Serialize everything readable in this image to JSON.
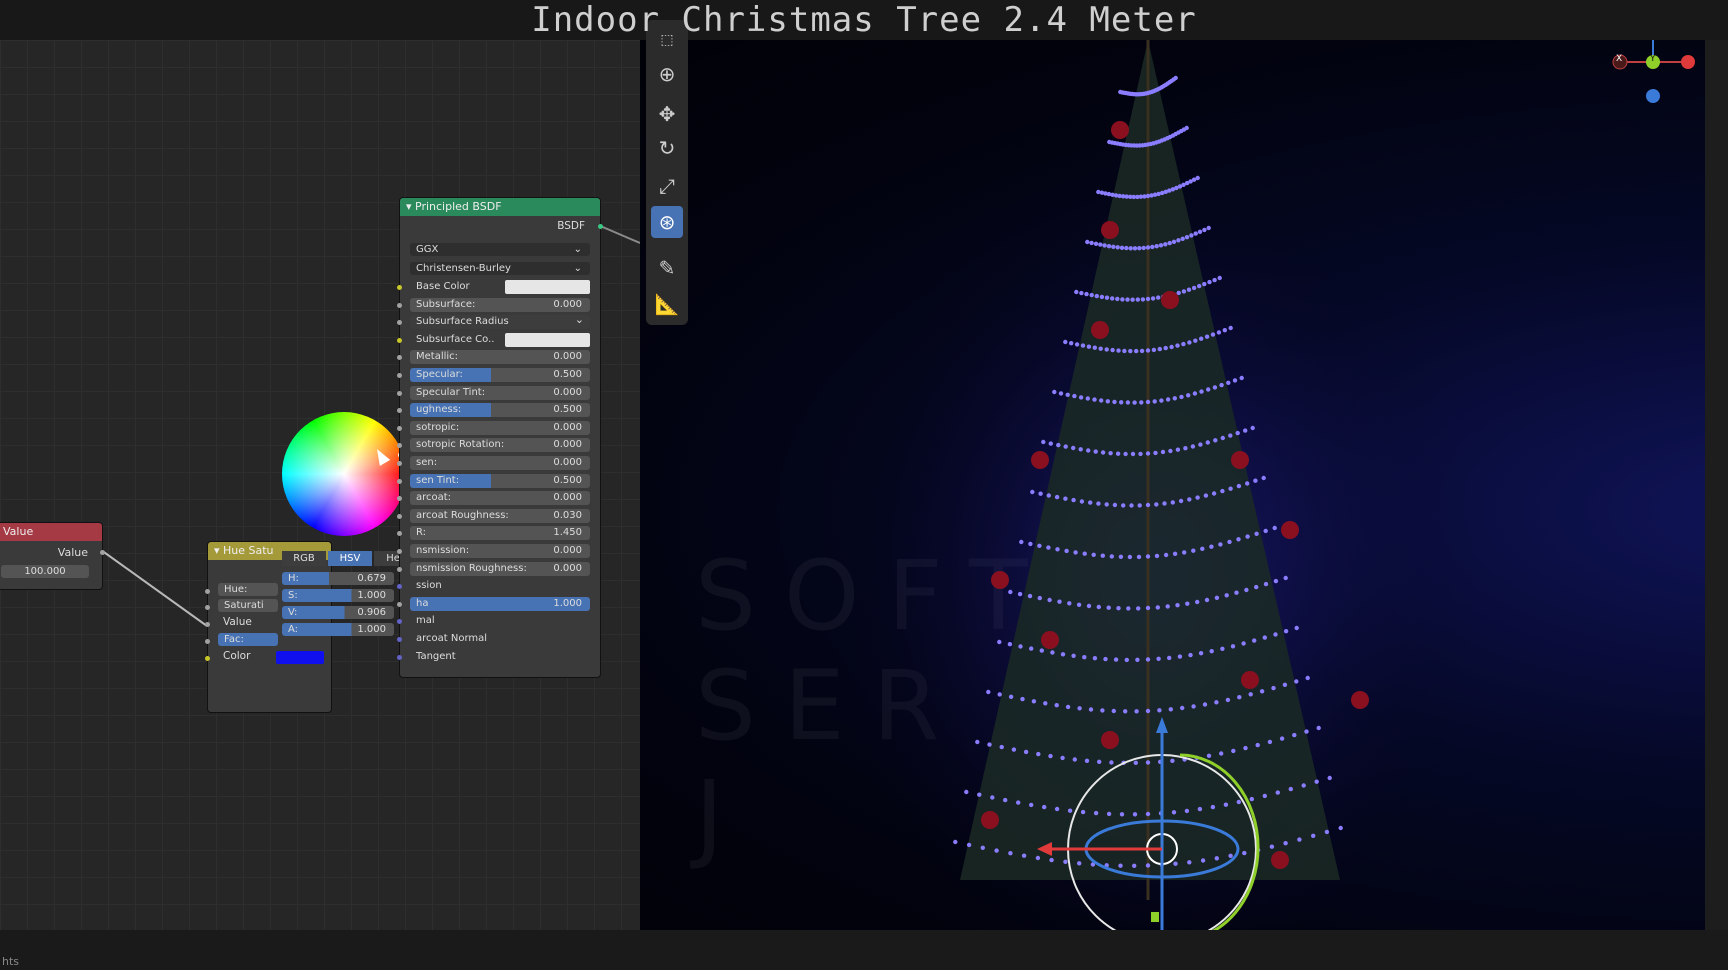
{
  "title": "Indoor Christmas Tree 2.4 Meter",
  "status_bar": {
    "text": "hts"
  },
  "value_node": {
    "header": "Value",
    "output_label": "Value",
    "value": "100.000"
  },
  "hue_node": {
    "header": "▾ Hue Satu",
    "inputs": [
      "Hue:",
      "Saturati",
      "Value",
      "Fac:",
      "Color"
    ],
    "color_swatch": "#1010ee"
  },
  "color_picker": {
    "tabs": [
      "RGB",
      "HSV",
      "Hex"
    ],
    "active_tab": "HSV",
    "fields": [
      {
        "label": "H:",
        "value": "0.679",
        "fraction": 0.679
      },
      {
        "label": "S:",
        "value": "1.000",
        "fraction": 1.0
      },
      {
        "label": "V:",
        "value": "0.906",
        "fraction": 0.906
      },
      {
        "label": "A:",
        "value": "1.000",
        "fraction": 1.0
      }
    ]
  },
  "bsdf_node": {
    "header": "▾ Principled BSDF",
    "output": "BSDF",
    "distribution": "GGX",
    "subsurface_method": "Christensen-Burley",
    "rows": [
      {
        "label": "Base Color",
        "type": "color"
      },
      {
        "label": "Subsurface:",
        "value": "0.000",
        "type": "slider"
      },
      {
        "label": "Subsurface Radius",
        "type": "dropdown"
      },
      {
        "label": "Subsurface Co..",
        "type": "color"
      },
      {
        "label": "Metallic:",
        "value": "0.000",
        "type": "slider"
      },
      {
        "label": "Specular:",
        "value": "0.500",
        "type": "slider-fill"
      },
      {
        "label": "Specular Tint:",
        "value": "0.000",
        "type": "slider"
      },
      {
        "label": "ughness:",
        "value": "0.500",
        "type": "slider-fill"
      },
      {
        "label": "sotropic:",
        "value": "0.000",
        "type": "slider"
      },
      {
        "label": "sotropic Rotation:",
        "value": "0.000",
        "type": "slider"
      },
      {
        "label": "sen:",
        "value": "0.000",
        "type": "slider"
      },
      {
        "label": "sen Tint:",
        "value": "0.500",
        "type": "slider-fill"
      },
      {
        "label": "arcoat:",
        "value": "0.000",
        "type": "slider"
      },
      {
        "label": "arcoat Roughness:",
        "value": "0.030",
        "type": "slider"
      },
      {
        "label": "R:",
        "value": "1.450",
        "type": "slider"
      },
      {
        "label": "nsmission:",
        "value": "0.000",
        "type": "slider"
      },
      {
        "label": "nsmission Roughness:",
        "value": "0.000",
        "type": "slider"
      },
      {
        "label": "ssion",
        "type": "socket-label"
      },
      {
        "label": "ha",
        "value": "1.000",
        "type": "slider-full"
      },
      {
        "label": "mal",
        "type": "socket-label"
      },
      {
        "label": "arcoat Normal",
        "type": "socket-label"
      },
      {
        "label": "Tangent",
        "type": "socket-label"
      }
    ]
  },
  "toolbar": {
    "tools": [
      "select-box-icon",
      "cursor-icon",
      "move-icon",
      "rotate-icon",
      "scale-icon",
      "transform-icon",
      "annotate-icon",
      "measure-icon"
    ],
    "active": "transform-icon"
  },
  "gizmo": {
    "axes": [
      "X",
      "Y",
      "Z"
    ]
  },
  "watermark": [
    "SOFT",
    "SER",
    "J"
  ],
  "colors": {
    "lights": "#5a4cff",
    "node_header_green": "#2a8a5c",
    "node_header_red": "#a53a45",
    "node_header_yellow": "#a59a3a",
    "accent": "#4772b3"
  }
}
